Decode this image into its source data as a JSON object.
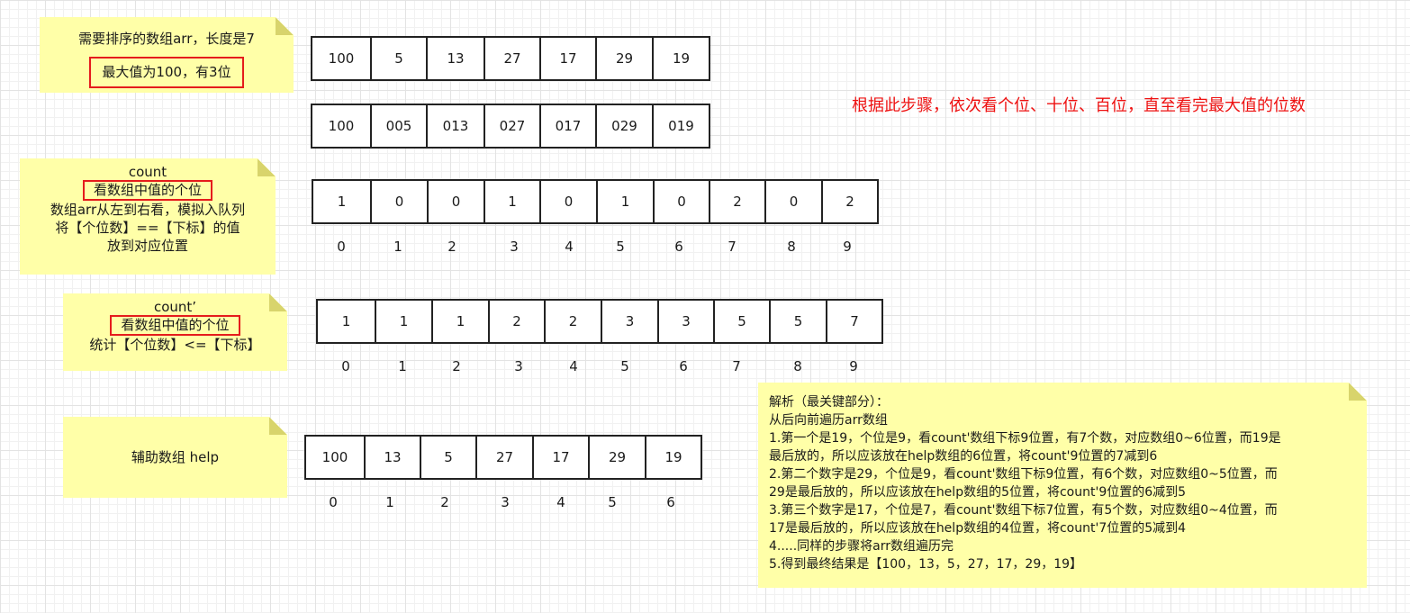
{
  "notes": {
    "sort": {
      "line1": "需要排序的数组arr，长度是7",
      "line2": "最大值为100，有3位"
    },
    "count": {
      "title": "count",
      "box": "看数组中值的个位",
      "line3": "数组arr从左到右看，模拟入队列",
      "line4": "将【个位数】==【下标】的值",
      "line5": "放到对应位置"
    },
    "countp": {
      "title": "count’",
      "box": "看数组中值的个位",
      "line3": "统计【个位数】<=【下标】"
    },
    "help": {
      "label": "辅助数组 help"
    },
    "analysis": {
      "lines": [
        "解析（最关键部分）：",
        "从后向前遍历arr数组",
        "1.第一个是19，个位是9，看count'数组下标9位置，有7个数，对应数组0~6位置，而19是",
        "最后放的，所以应该放在help数组的6位置，将count'9位置的7减到6",
        "2.第二个数字是29，个位是9，看count'数组下标9位置，有6个数，对应数组0~5位置，而",
        "29是最后放的，所以应该放在help数组的5位置，将count'9位置的6减到5",
        "3.第三个数字是17，个位是7，看count'数组下标7位置，有5个数，对应数组0~4位置，而",
        "17是最后放的，所以应该放在help数组的4位置，将count'7位置的5减到4",
        "4.....同样的步骤将arr数组遍历完",
        "5.得到最终结果是【100，13，5，27，17，29，19】"
      ]
    }
  },
  "red_note": "根据此步骤，依次看个位、十位、百位，直至看完最大值的位数",
  "arrays": {
    "arr": [
      "100",
      "5",
      "13",
      "27",
      "17",
      "29",
      "19"
    ],
    "arr_padded": [
      "100",
      "005",
      "013",
      "027",
      "017",
      "029",
      "019"
    ],
    "count": [
      "1",
      "0",
      "0",
      "1",
      "0",
      "1",
      "0",
      "2",
      "0",
      "2"
    ],
    "count_prime": [
      "1",
      "1",
      "1",
      "2",
      "2",
      "3",
      "3",
      "5",
      "5",
      "7"
    ],
    "help": [
      "100",
      "13",
      "5",
      "27",
      "17",
      "29",
      "19"
    ]
  },
  "indices": {
    "ten": [
      "0",
      "1",
      "2",
      "3",
      "4",
      "5",
      "6",
      "7",
      "8",
      "9"
    ],
    "seven": [
      "0",
      "1",
      "2",
      "3",
      "4",
      "5",
      "6"
    ]
  },
  "colors": {
    "note": "#ffffa8",
    "red": "#e51c1c",
    "grid": "#e3e3e3"
  }
}
